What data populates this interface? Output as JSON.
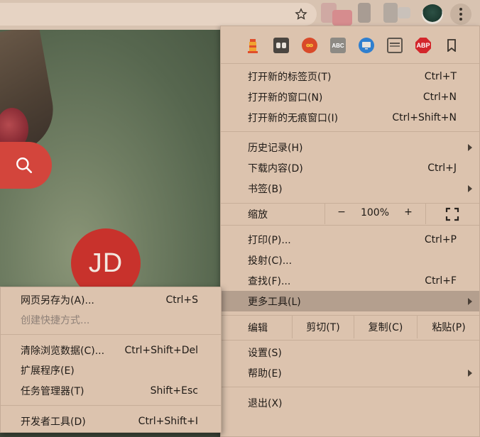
{
  "page": {
    "avatar_text": "JD"
  },
  "menu": {
    "new_tab": {
      "label": "打开新的标签页(T)",
      "shortcut": "Ctrl+T"
    },
    "new_window": {
      "label": "打开新的窗口(N)",
      "shortcut": "Ctrl+N"
    },
    "new_incognito": {
      "label": "打开新的无痕窗口(I)",
      "shortcut": "Ctrl+Shift+N"
    },
    "history": {
      "label": "历史记录(H)"
    },
    "downloads": {
      "label": "下载内容(D)",
      "shortcut": "Ctrl+J"
    },
    "bookmarks": {
      "label": "书签(B)"
    },
    "zoom": {
      "label": "缩放",
      "minus": "−",
      "value": "100%",
      "plus": "+"
    },
    "print": {
      "label": "打印(P)...",
      "shortcut": "Ctrl+P"
    },
    "cast": {
      "label": "投射(C)..."
    },
    "find": {
      "label": "查找(F)...",
      "shortcut": "Ctrl+F"
    },
    "more_tools": {
      "label": "更多工具(L)"
    },
    "edit": {
      "label": "编辑",
      "cut": "剪切(T)",
      "copy": "复制(C)",
      "paste": "粘贴(P)"
    },
    "settings": {
      "label": "设置(S)"
    },
    "help": {
      "label": "帮助(E)"
    },
    "exit": {
      "label": "退出(X)"
    }
  },
  "submenu": {
    "save_page": {
      "label": "网页另存为(A)...",
      "shortcut": "Ctrl+S"
    },
    "create_shortcut": {
      "label": "创建快捷方式..."
    },
    "clear_data": {
      "label": "清除浏览数据(C)...",
      "shortcut": "Ctrl+Shift+Del"
    },
    "extensions": {
      "label": "扩展程序(E)"
    },
    "task_manager": {
      "label": "任务管理器(T)",
      "shortcut": "Shift+Esc"
    },
    "dev_tools": {
      "label": "开发者工具(D)",
      "shortcut": "Ctrl+Shift+I"
    }
  },
  "extensions": {
    "abp_text": "ABP",
    "ext3_text": "ABC"
  },
  "colors": {
    "menu_bg": "#dcc3ae",
    "highlight": "#b49f8e",
    "accent_red": "#d3453c"
  }
}
